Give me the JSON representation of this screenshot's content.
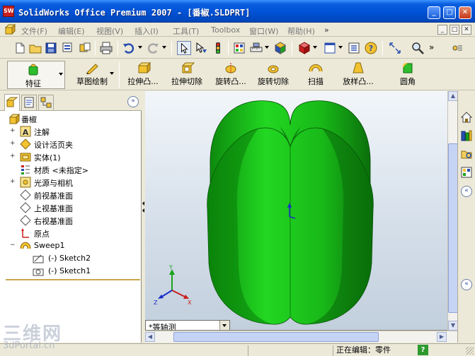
{
  "window": {
    "app_icon": "SW",
    "title": "SolidWorks Office Premium 2007 - [番椒.SLDPRT]",
    "minimize": "_",
    "maximize": "□",
    "close": "✕"
  },
  "menubar": {
    "items": [
      "文件(F)",
      "编辑(E)",
      "视图(V)",
      "插入(I)",
      "工具(T)",
      "Toolbox",
      "窗口(W)",
      "帮助(H)"
    ],
    "overflow": "»",
    "mdi_minimize": "_",
    "mdi_restore": "□",
    "mdi_close": "✕"
  },
  "command_manager": {
    "commands": [
      "特征",
      "草图绘制",
      "拉伸凸...",
      "拉伸切除",
      "旋转凸...",
      "旋转切除",
      "扫描",
      "放样凸...",
      "圆角"
    ]
  },
  "feature_tree": {
    "collapse_glyph": "»",
    "root": "番椒",
    "items": [
      {
        "label": "注解",
        "icon": "annotation-icon",
        "expander": "+"
      },
      {
        "label": "设计活页夹",
        "icon": "design-binder-icon",
        "expander": "+"
      },
      {
        "label": "实体(1)",
        "icon": "solid-bodies-icon",
        "expander": "+"
      },
      {
        "label": "材质 <未指定>",
        "icon": "material-icon",
        "expander": ""
      },
      {
        "label": "光源与相机",
        "icon": "lights-cameras-icon",
        "expander": "+"
      },
      {
        "label": "前视基准面",
        "icon": "plane-icon",
        "expander": ""
      },
      {
        "label": "上视基准面",
        "icon": "plane-icon",
        "expander": ""
      },
      {
        "label": "右视基准面",
        "icon": "plane-icon",
        "expander": ""
      },
      {
        "label": "原点",
        "icon": "origin-icon",
        "expander": ""
      },
      {
        "label": "Sweep1",
        "icon": "sweep-feature-icon",
        "expander": "−"
      },
      {
        "label": "(-) Sketch2",
        "icon": "sketch-icon",
        "expander": ""
      },
      {
        "label": "(-) Sketch1",
        "icon": "sketch-icon",
        "expander": ""
      }
    ]
  },
  "viewport": {
    "view_orientation": "*等轴测",
    "model_color": "#1fd11f",
    "triad": {
      "x": "X",
      "y": "Y",
      "z": "Z"
    }
  },
  "statusbar": {
    "editing": "正在编辑：零件",
    "help": "?"
  },
  "watermark": {
    "chinese": "三维网",
    "url": "3dPortal.cn"
  },
  "colors": {
    "titlebar": "#0052d6",
    "accent": "#2a4a9a",
    "model": "#1fd11f"
  }
}
